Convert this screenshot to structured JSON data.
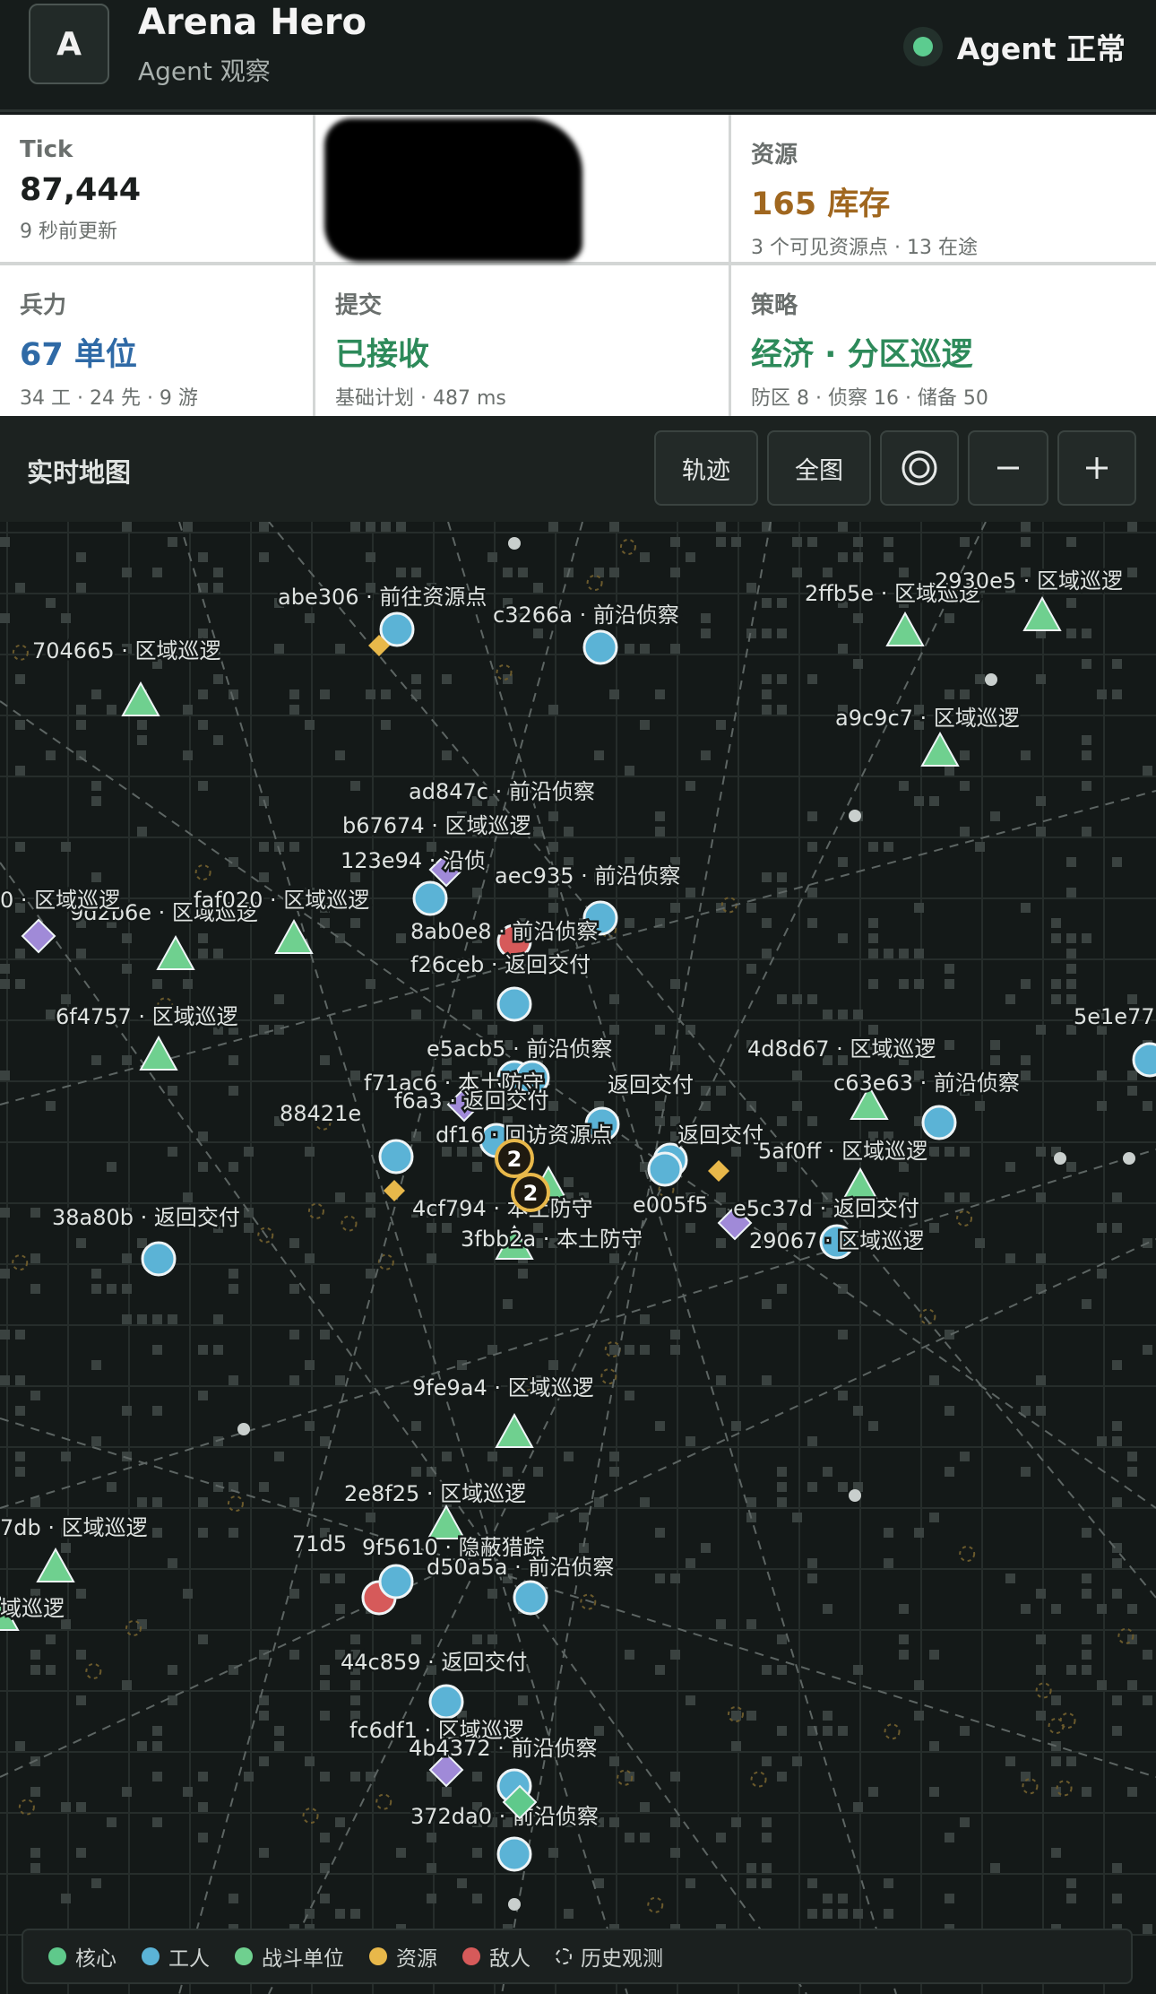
{
  "header": {
    "logo_letter": "A",
    "title": "Arena Hero",
    "subtitle": "Agent 观察",
    "status_text": "Agent 正常"
  },
  "stats": {
    "tick": {
      "label": "Tick",
      "value": "87,444",
      "sub": "9 秒前更新"
    },
    "resources": {
      "label": "资源",
      "value": "165 库存",
      "sub": "3 个可见资源点 · 13 在途",
      "color": "#a0671f"
    },
    "forces": {
      "label": "兵力",
      "value": "67 单位",
      "sub": "34 工 · 24 先 · 9 游",
      "color": "#2f6aa6"
    },
    "submit": {
      "label": "提交",
      "value": "已接收",
      "sub": "基础计划 · 487 ms",
      "color": "#2d8a5a"
    },
    "strategy": {
      "label": "策略",
      "value": "经济 · 分区巡逻",
      "sub": "防区 8 · 侦察 16 · 储备 50",
      "color": "#2d8a5a"
    }
  },
  "map_toolbar": {
    "title": "实时地图",
    "trail_button": "轨迹",
    "fullmap_button": "全图",
    "target_icon": "target-icon",
    "zoom_out_icon": "minus-icon",
    "zoom_in_icon": "plus-icon"
  },
  "colors": {
    "core": "#5fc98b",
    "worker": "#5bb3d6",
    "combat": "#6fd08f",
    "resource": "#e8b84a",
    "enemy": "#d65a5a",
    "scout": "#a08ad8"
  },
  "map_units": [
    {
      "label": "abe306 · 前往资源点",
      "kind": "worker"
    },
    {
      "label": "c3266a · 前沿侦察",
      "kind": "worker"
    },
    {
      "label": "2ffb5e · 区域巡逻",
      "kind": "combat"
    },
    {
      "label": "2930e5 · 区域巡逻",
      "kind": "combat"
    },
    {
      "label": "704665 · 区域巡逻",
      "kind": "combat"
    },
    {
      "label": "a9c9c7 · 区域巡逻",
      "kind": "combat"
    },
    {
      "label": "ad847c · 前沿侦察",
      "kind": "scout"
    },
    {
      "label": "b67674 · 区域巡逻",
      "kind": "scout"
    },
    {
      "label": "123e94 · 沿侦",
      "kind": "worker"
    },
    {
      "label": "aec935 · 前沿侦察",
      "kind": "worker"
    },
    {
      "label": "9d2b6e · 区域巡逻",
      "kind": "combat"
    },
    {
      "label": "faf020 · 区域巡逻",
      "kind": "combat"
    },
    {
      "label": "8ab0e8 · 前沿侦察",
      "kind": "enemy"
    },
    {
      "label": "f26ceb · 返回交付",
      "kind": "worker"
    },
    {
      "label": "6f4757 · 区域巡逻",
      "kind": "combat"
    },
    {
      "label": "5e1e77",
      "kind": "worker"
    },
    {
      "label": "e5acb5 · 前沿侦察",
      "kind": "worker"
    },
    {
      "label": "4d8d67 · 区域巡逻",
      "kind": "combat"
    },
    {
      "label": "f71ac6 · 本土防守",
      "kind": "worker"
    },
    {
      "label": "c63e63 · 前沿侦察",
      "kind": "worker"
    },
    {
      "label": "f6a3 · 返回交付",
      "kind": "scout"
    },
    {
      "label": "返回交付",
      "kind": "worker"
    },
    {
      "label": "88421e",
      "kind": "worker"
    },
    {
      "label": "df16 · 回访资源点",
      "kind": "worker"
    },
    {
      "label": "返回交付",
      "kind": "worker"
    },
    {
      "label": "5af0ff · 区域巡逻",
      "kind": "combat"
    },
    {
      "label": "4cf794 · 本土防守",
      "kind": "combat"
    },
    {
      "label": "e005f5",
      "kind": "worker"
    },
    {
      "label": "e5c37d · 返回交付",
      "kind": "scout"
    },
    {
      "label": "38a80b · 返回交付",
      "kind": "worker"
    },
    {
      "label": "3fbb2a · 本土防守",
      "kind": "combat"
    },
    {
      "label": "29067 · 区域巡逻",
      "kind": "worker"
    },
    {
      "label": "9fe9a4 · 区域巡逻",
      "kind": "combat"
    },
    {
      "label": "2e8f25 · 区域巡逻",
      "kind": "combat"
    },
    {
      "label": "7db · 区域巡逻",
      "kind": "combat"
    },
    {
      "label": "71d5",
      "kind": "enemy"
    },
    {
      "label": "9f5610 · 隐蔽猎踪",
      "kind": "worker"
    },
    {
      "label": "d50a5a · 前沿侦察",
      "kind": "worker"
    },
    {
      "label": "域巡逻",
      "kind": "combat"
    },
    {
      "label": "44c859 · 返回交付",
      "kind": "worker"
    },
    {
      "label": "fc6df1 · 区域巡逻",
      "kind": "scout"
    },
    {
      "label": "4b4372 · 前沿侦察",
      "kind": "worker"
    },
    {
      "label": "372da0 · 前沿侦察",
      "kind": "worker"
    },
    {
      "label": "0 · 区域巡逻",
      "kind": "scout"
    }
  ],
  "clusters": [
    {
      "count": "2"
    },
    {
      "count": "2"
    }
  ],
  "legend": [
    {
      "label": "核心",
      "color": "#5fc98b"
    },
    {
      "label": "工人",
      "color": "#5bb3d6"
    },
    {
      "label": "战斗单位",
      "color": "#6fd08f"
    },
    {
      "label": "资源",
      "color": "#e8b84a"
    },
    {
      "label": "敌人",
      "color": "#d65a5a"
    },
    {
      "label": "历史观测",
      "color": "#cfd4d2"
    }
  ]
}
